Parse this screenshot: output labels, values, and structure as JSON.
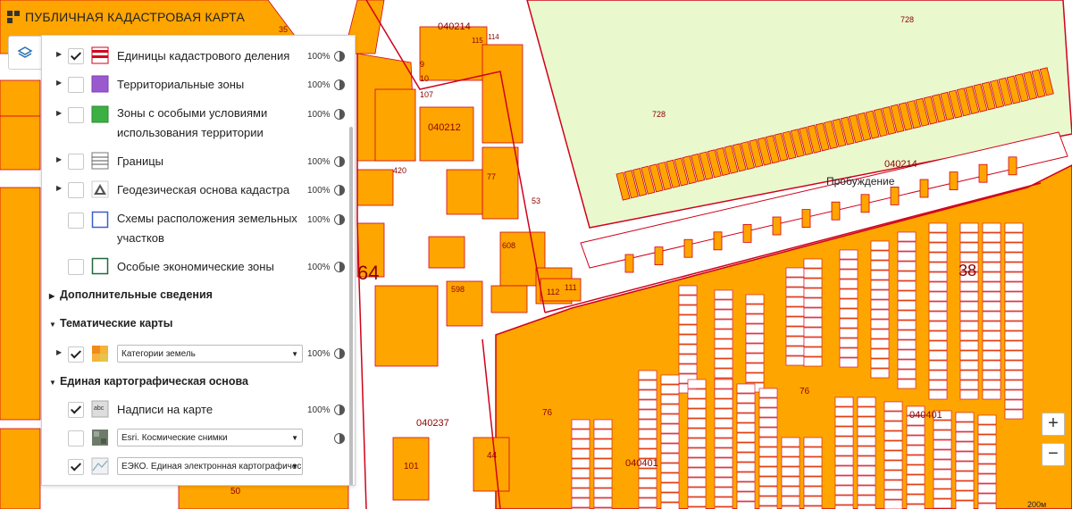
{
  "header": {
    "title": "ПУБЛИЧНАЯ КАДАСТРОВАЯ КАРТА"
  },
  "icons": {
    "logo": "pkk-logo-icon",
    "layers": "layers-icon",
    "opacity": "half-circle-icon"
  },
  "colors": {
    "parcel": "#FFA500",
    "border": "#D0021B",
    "zone": "#EAF8CE",
    "panel_bg": "#FFFFFF"
  },
  "layers": [
    {
      "label": "Единицы кадастрового деления",
      "checked": true,
      "opacity": "100%",
      "swatch": "cadastral-division-icon"
    },
    {
      "label": "Территориальные зоны",
      "checked": false,
      "opacity": "100%",
      "swatch": "territorial-zones-icon"
    },
    {
      "label": "Зоны с особыми условиями",
      "label2": "использования территории",
      "checked": false,
      "opacity": "100%",
      "swatch": "special-zones-icon"
    },
    {
      "label": "Границы",
      "checked": false,
      "opacity": "100%",
      "swatch": "borders-icon"
    },
    {
      "label": "Геодезическая основа кадастра",
      "checked": false,
      "opacity": "100%",
      "swatch": "geodetic-icon"
    },
    {
      "label": "Схемы расположения земельных",
      "label2": "участков",
      "checked": false,
      "opacity": "100%",
      "swatch": "layout-schemes-icon"
    },
    {
      "label": "Особые экономические зоны",
      "checked": false,
      "opacity": "100%",
      "swatch": "economic-zones-icon"
    }
  ],
  "sections": {
    "additional": "Дополнительные сведения",
    "thematic": "Тематические карты",
    "basemap": "Единая картографическая основа"
  },
  "thematic": {
    "select": "Категории земель",
    "opacity": "100%"
  },
  "basemap": {
    "labels": {
      "label": "Надписи на карте",
      "opacity": "100%"
    },
    "esri": {
      "select": "Esri. Космические снимки"
    },
    "eeko": {
      "select": "ЕЭКО. Единая электронная картографическ"
    }
  },
  "map_labels": {
    "q040214": "040214",
    "q040212": "040212",
    "q040237": "040237",
    "q040401a": "040401",
    "q040401b": "040401",
    "q040214b": "040214",
    "p728a": "728",
    "p728b": "728",
    "street": "Пробуждение",
    "n64": "64",
    "n38": "38",
    "n76a": "76",
    "n76b": "76",
    "n101": "101",
    "n44": "44",
    "n50": "50",
    "n107": "107",
    "n9": "9",
    "n10": "10",
    "n420": "420",
    "n608": "608",
    "n598": "598",
    "n53": "53",
    "n77": "77",
    "n112": "112",
    "n111": "111",
    "n35": "35",
    "n115": "115",
    "n114": "114"
  },
  "map_controls": {
    "zoom_in": "+",
    "zoom_out": "−",
    "scale": "200м"
  }
}
